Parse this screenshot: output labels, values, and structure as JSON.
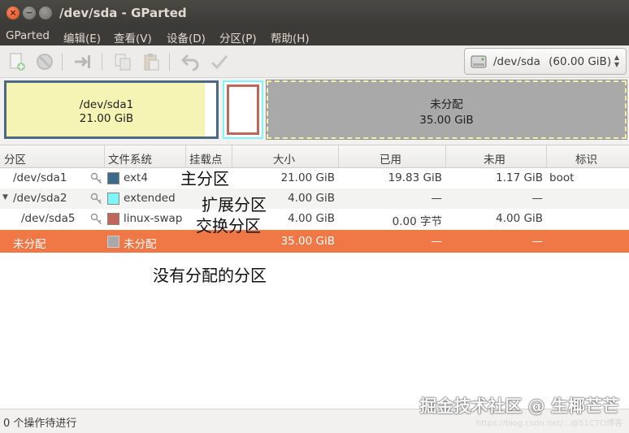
{
  "window": {
    "title": "/dev/sda - GParted"
  },
  "menu": [
    "GParted",
    "编辑(E)",
    "查看(V)",
    "设备(D)",
    "分区(P)",
    "帮助(H)"
  ],
  "toolbar": {
    "icons": [
      "new-partition-icon",
      "delete-icon",
      "resize-move-icon",
      "copy-icon",
      "paste-icon",
      "undo-icon",
      "apply-icon"
    ],
    "device_selector": {
      "label": "/dev/sda",
      "size": "(60.00 GiB)"
    }
  },
  "disk_map": {
    "sda1": {
      "name": "/dev/sda1",
      "size": "21.00 GiB",
      "used_fraction": 0.944
    },
    "unallocated": {
      "name": "未分配",
      "size": "35.00 GiB"
    }
  },
  "table": {
    "headers": [
      "分区",
      "文件系统",
      "挂载点",
      "大小",
      "已用",
      "未用",
      "标识"
    ],
    "rows": [
      {
        "partition": "/dev/sda1",
        "fs": "ext4",
        "fs_color": "#3d6a8a",
        "size": "21.00 GiB",
        "used": "19.83 GiB",
        "unused": "1.17 GiB",
        "flags": "boot"
      },
      {
        "partition": "/dev/sda2",
        "fs": "extended",
        "fs_color": "#7ef5f6",
        "size": "4.00 GiB",
        "used": "—",
        "unused": "—",
        "flags": ""
      },
      {
        "partition": "/dev/sda5",
        "fs": "linux-swap",
        "fs_color": "#c1665a",
        "size": "4.00 GiB",
        "used": "0.00 字节",
        "unused": "4.00 GiB",
        "flags": ""
      },
      {
        "partition": "未分配",
        "fs": "未分配",
        "fs_color": "#a9a9a9",
        "size": "35.00 GiB",
        "used": "—",
        "unused": "—",
        "flags": ""
      }
    ]
  },
  "annotations": {
    "primary": "主分区",
    "extended": "扩展分区",
    "swap": "交换分区",
    "unallocated": "没有分配的分区"
  },
  "status": {
    "text": "0 个操作待进行"
  },
  "watermark": {
    "main": "掘金技术社区 @ 生椰芒芒",
    "sub": "https://blog.csdn.net/...@51CTO博客"
  },
  "colors": {
    "selection": "#f07746",
    "titlebar": "#3b3a36",
    "close_button": "#df4a16"
  }
}
